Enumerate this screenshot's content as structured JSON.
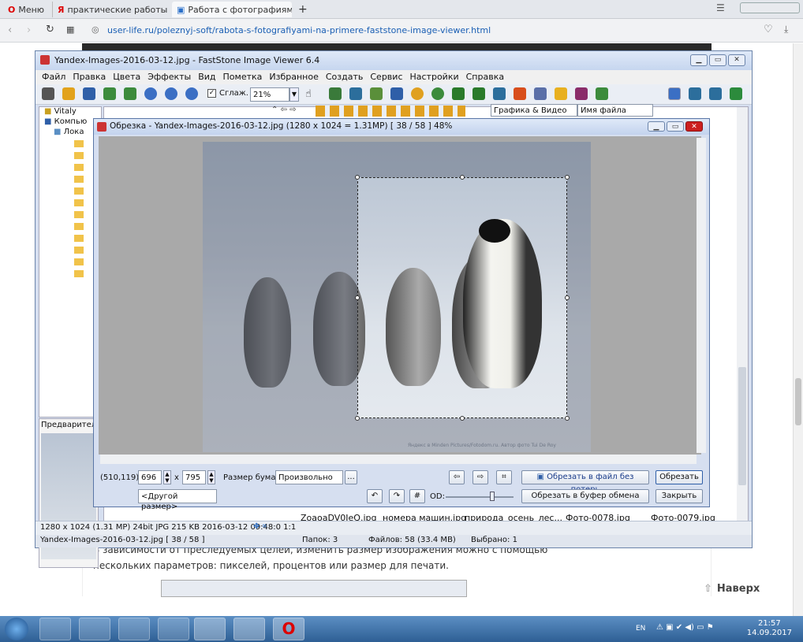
{
  "browser": {
    "tabs": [
      {
        "label": "Меню"
      },
      {
        "label": "практические работы по",
        "close": "✕"
      },
      {
        "label": "Работа с фотографиями",
        "close": "✕"
      }
    ],
    "new_tab": "+",
    "url": "user-life.ru/poleznyj-soft/rabota-s-fotografiyami-na-primere-faststone-image-viewer.html"
  },
  "article": {
    "line1": "В зависимости от преследуемых целей, изменить размер изображения можно с помощью",
    "line2": "нескольких параметров: пикселей, процентов или размер для печати.",
    "scroll_top": "Наверх"
  },
  "faststone": {
    "title": "Yandex-Images-2016-03-12.jpg  -  FastStone Image Viewer 6.4",
    "menu": [
      "Файл",
      "Правка",
      "Цвета",
      "Эффекты",
      "Вид",
      "Пометка",
      "Избранное",
      "Создать",
      "Сервис",
      "Настройки",
      "Справка"
    ],
    "smooth_label": "Сглаж.",
    "zoom": "21%",
    "filter": "Графика & Видео",
    "sort": "Имя файла",
    "tree": {
      "root": "Vitaly",
      "computer": "Компью",
      "local": "Лока"
    },
    "preview_label": "Предварительны",
    "thumb_captions": [
      "ZoaoaDV0IeQ.jpg",
      "номера машин.jpg",
      "природа_осень_лес...",
      "Фото-0078.jpg",
      "Фото-0079.jpg"
    ],
    "status_info": "1280 x 1024 (1.31 MP)  24bit  JPG  215 KB  2016-03-12 09:48:0 1:1",
    "status_file": "Yandex-Images-2016-03-12.jpg [ 38 / 58 ]",
    "folders": "Папок: 3",
    "files": "Файлов: 58 (33.4 MB)",
    "selected": "Выбрано: 1"
  },
  "crop": {
    "title": "Обрезка  -  Yandex-Images-2016-03-12.jpg  (1280 x 1024 = 1.31MP)  [ 38 / 58 ]   48%",
    "coords": "(510,119)",
    "width": "696",
    "height": "795",
    "times": "x",
    "paper_label": "Размер бумаги:",
    "paper_value": "Произвольно",
    "ellipsis": "...",
    "other_size": "<Другой размер>",
    "od_label": "OD:",
    "btn_crop_lossless": "Обрезать в файл без потерь",
    "btn_crop": "Обрезать",
    "btn_crop_clipboard": "Обрезать в буфер обмена",
    "btn_close": "Закрыть",
    "watermark": "Яндекс в Minden Pictures/Fotodom.ru. Автор фото Tui De Roy"
  },
  "taskbar": {
    "lang": "EN",
    "time": "21:57",
    "date": "14.09.2017"
  },
  "colors": {
    "taskbar": "#2e5f94",
    "window_frame": "#6b84aa",
    "accent_red": "#cc1f1f"
  }
}
